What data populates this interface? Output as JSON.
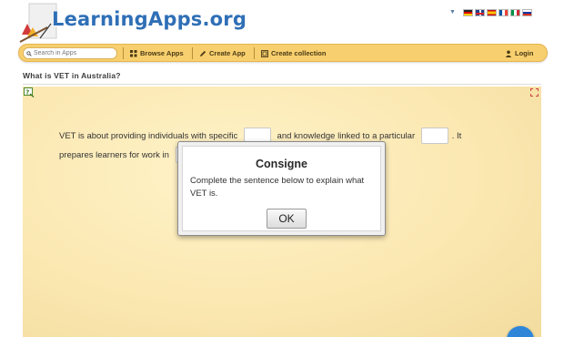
{
  "header": {
    "logo_text": "LearningApps.org",
    "languages": [
      "de",
      "gb",
      "es",
      "fr",
      "it",
      "ru"
    ]
  },
  "navbar": {
    "search_placeholder": "Search in Apps",
    "browse_label": "Browse Apps",
    "create_label": "Create App",
    "collection_label": "Create collection",
    "login_label": "Login"
  },
  "page": {
    "title": "What is VET in Australia?"
  },
  "app": {
    "sentence_part1": "VET is about providing individuals with specific",
    "sentence_part2": "and knowledge linked to a particular",
    "sentence_part3": ". It prepares learners for work in",
    "gap1_value": "",
    "gap2_value": "",
    "gap3_value": ""
  },
  "dialog": {
    "title": "Consigne",
    "text": "Complete the sentence below to explain what VET is.",
    "ok_label": "OK"
  },
  "colors": {
    "navbar": "#f7cf6e",
    "logo": "#2f6fb6",
    "app_background": "#fbe8b2",
    "fab": "#2f86d9"
  }
}
